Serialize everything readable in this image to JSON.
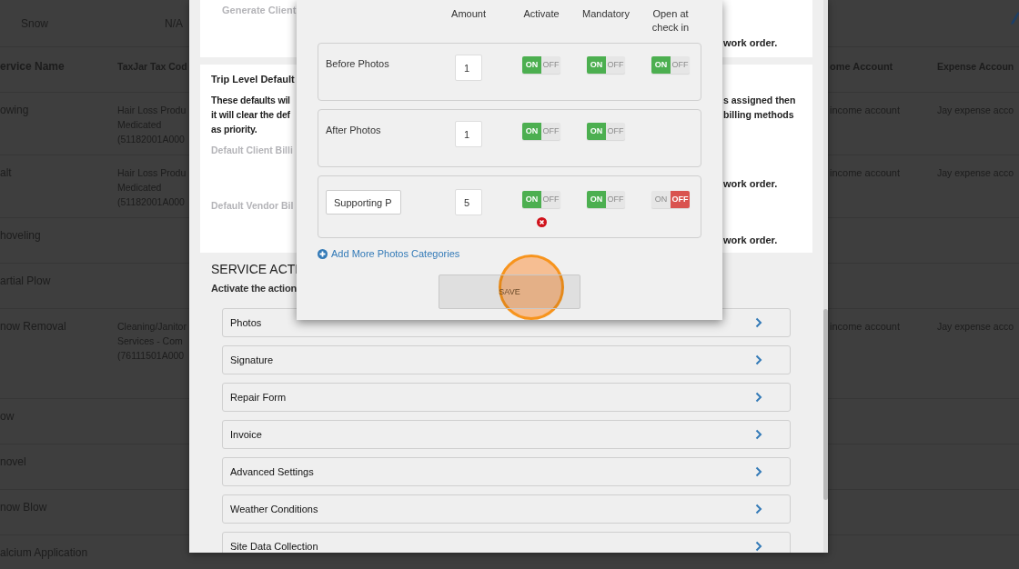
{
  "background_table": {
    "top_row": {
      "service": "Snow",
      "tax_code": "N/A"
    },
    "columns": {
      "service": "ervice Name",
      "tax_code": "TaxJar Tax Cod",
      "income": "ome Account",
      "expense": "Expense Accoun"
    },
    "rows": [
      {
        "service": "owing",
        "tax_code": "Hair Loss Produ\nMedicated\n(51182001A000",
        "income": "income account",
        "expense": "Jay expense acco"
      },
      {
        "service": "alt",
        "tax_code": "Hair Loss Produ\nMedicated\n(51182001A000",
        "income": "income account",
        "expense": "Jay expense acco"
      },
      {
        "service": "hoveling"
      },
      {
        "service": "artial Plow"
      },
      {
        "service": "now Removal",
        "tax_code": "Cleaning/Janitor\nServices - Com\n(76111501A000",
        "income": "income account",
        "expense": "Jay expense acco"
      },
      {
        "service": "ow"
      },
      {
        "service": "novel"
      },
      {
        "service": "now Blow"
      },
      {
        "service": "alcium Application"
      }
    ]
  },
  "settings_panel": {
    "client_card": {
      "label": "Generate Client",
      "note": "work order."
    },
    "trip_card": {
      "title": "Trip Level Default",
      "description_left": "These defaults wil\nit will clear the def\nas priority.",
      "description_right": "s assigned then\nbilling methods",
      "client_label": "Default Client Billi",
      "client_note": "work order.",
      "vendor_label": "Default Vendor Bil",
      "vendor_note": "work order."
    },
    "section_title": "SERVICE ACTI",
    "section_subtitle": "Activate the action",
    "actions": [
      "Photos",
      "Signature",
      "Repair Form",
      "Invoice",
      "Advanced Settings",
      "Weather Conditions",
      "Site Data Collection"
    ]
  },
  "modal": {
    "columns": [
      "Amount",
      "Activate",
      "Mandatory",
      "Open at check in"
    ],
    "rows": [
      {
        "kind": "label",
        "name": "Before Photos",
        "amount": "1",
        "error": false,
        "toggles": [
          {
            "on_text": "ON",
            "off_text": "OFF",
            "on": true
          },
          {
            "on_text": "ON",
            "off_text": "OFF",
            "on": true
          },
          {
            "on_text": "ON",
            "off_text": "OFF",
            "on": true
          }
        ]
      },
      {
        "kind": "label",
        "name": "After Photos",
        "amount": "1",
        "error": false,
        "toggles": [
          {
            "on_text": "ON",
            "off_text": "OFF",
            "on": true
          },
          {
            "on_text": "ON",
            "off_text": "OFF",
            "on": true
          }
        ]
      },
      {
        "kind": "input",
        "name": "Supporting P",
        "amount": "5",
        "error": true,
        "toggles": [
          {
            "on_text": "ON",
            "off_text": "OFF",
            "on": true
          },
          {
            "on_text": "ON",
            "off_text": "OFF",
            "on": true
          },
          {
            "on_text": "ON",
            "off_text": "OFF",
            "on": false
          }
        ]
      }
    ],
    "add_link": "Add More Photos Categories",
    "save_button": "SAVE"
  }
}
